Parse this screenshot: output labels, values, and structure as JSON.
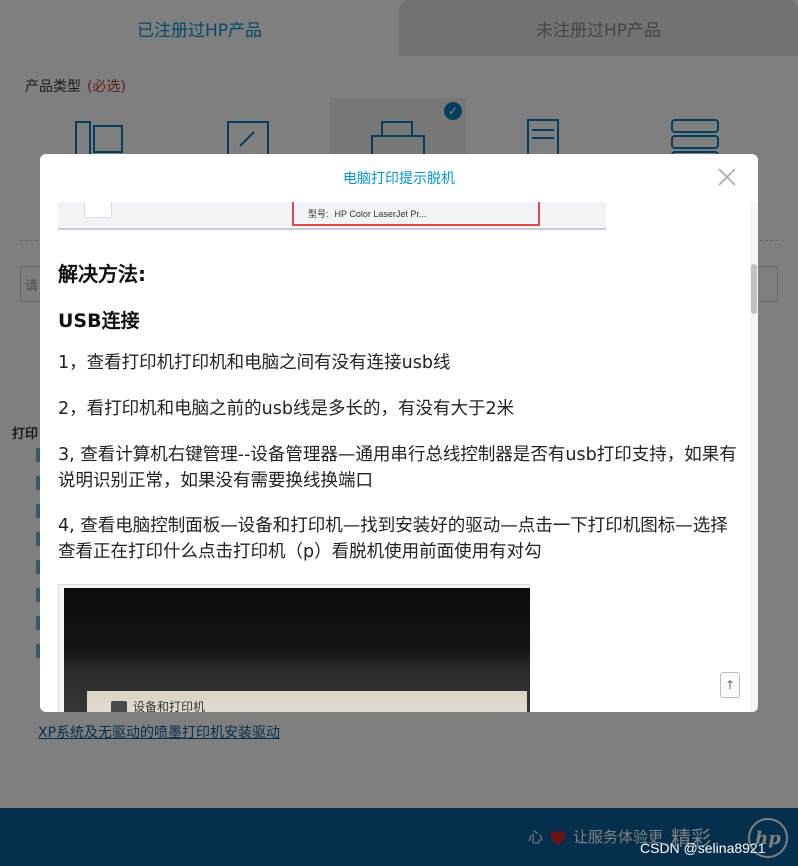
{
  "tabs": {
    "registered": "已注册过HP产品",
    "unregistered": "未注册过HP产品"
  },
  "product_type": {
    "label": "产品类型",
    "required": "(必选)"
  },
  "search": {
    "placeholder": "请"
  },
  "left_panel": {
    "print_label": "打印"
  },
  "xp_link": "XP系统及无驱动的喷墨打印机安装驱动",
  "footer": {
    "slogan": "让服务体验更",
    "slogan_emphasis": "精彩",
    "heart_prefix": "心",
    "logo": "hp"
  },
  "modal": {
    "title": "电脑打印提示脱机",
    "top_screenshot": {
      "model_label": "型号:",
      "model_value": "HP Color LaserJet Pr..."
    },
    "solution_heading": "解决方法:",
    "usb_heading": "USB连接",
    "steps": [
      "1，查看打印机打印机和电脑之间有没有连接usb线",
      "2，看打印机和电脑之前的usb线是多长的，有没有大于2米",
      "3, 查看计算机右键管理--设备管理器—通用串行总线控制器是否有usb打印支持，如果有说明识别正常，如果没有需要换线换端口",
      "4, 查看电脑控制面板—设备和打印机—找到安装好的驱动—点击一下打印机图标—选择查看正在打印什么点击打印机（p）看脱机使用前面使用有对勾"
    ],
    "photo": {
      "window_title": "设备和打印机"
    },
    "back_top": "↑"
  },
  "watermark": "CSDN @selina8921",
  "colors": {
    "accent": "#0096d6",
    "footer_bg": "#0b5e99",
    "required_red": "#c0392b",
    "link_blue": "#0a5a9c"
  }
}
